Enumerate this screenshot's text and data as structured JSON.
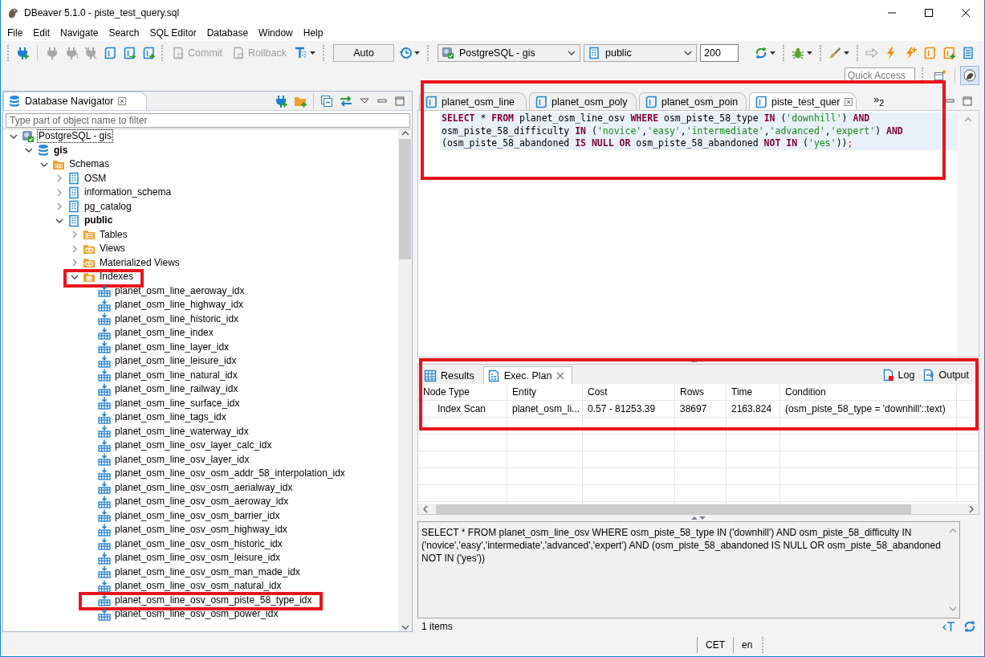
{
  "window": {
    "title": "DBeaver 5.1.0 - piste_test_query.sql"
  },
  "menu": [
    "File",
    "Edit",
    "Navigate",
    "Search",
    "SQL Editor",
    "Database",
    "Window",
    "Help"
  ],
  "toolbar": [
    {
      "kind": "grip"
    },
    {
      "kind": "icon",
      "disabled": false,
      "menu": false
    },
    {
      "kind": "divider"
    },
    {
      "kind": "icon",
      "disabled": true,
      "menu": false
    },
    {
      "kind": "icon",
      "disabled": true,
      "menu": false
    },
    {
      "kind": "icon",
      "disabled": true,
      "menu": false
    },
    {
      "kind": "icon",
      "disabled": false,
      "menu": false
    },
    {
      "kind": "icon",
      "disabled": false,
      "menu": false
    },
    {
      "kind": "icon",
      "disabled": false,
      "menu": false
    },
    {
      "kind": "grip"
    },
    {
      "kind": "button",
      "label": "Commit",
      "disabled": true
    },
    {
      "kind": "button",
      "label": "Rollback",
      "disabled": true
    },
    {
      "kind": "icon",
      "disabled": false,
      "menu": true
    },
    {
      "kind": "grip"
    },
    {
      "kind": "box",
      "label": "Auto"
    },
    {
      "kind": "icon",
      "disabled": false,
      "menu": true
    },
    {
      "kind": "grip"
    },
    {
      "kind": "select",
      "value": "PostgreSQL - gis"
    },
    {
      "kind": "select",
      "value": "public"
    },
    {
      "kind": "input",
      "value": "200"
    },
    {
      "kind": "icon",
      "disabled": false,
      "menu": true
    },
    {
      "kind": "grip"
    },
    {
      "kind": "icon",
      "disabled": false,
      "menu": true
    },
    {
      "kind": "grip"
    },
    {
      "kind": "icon",
      "disabled": false,
      "menu": true
    },
    {
      "kind": "grip"
    },
    {
      "kind": "icon",
      "disabled": true,
      "menu": false
    },
    {
      "kind": "icon",
      "disabled": false,
      "menu": false
    },
    {
      "kind": "icon",
      "disabled": false,
      "menu": false
    },
    {
      "kind": "icon",
      "disabled": false,
      "menu": false
    },
    {
      "kind": "icon",
      "disabled": false,
      "menu": false
    },
    {
      "kind": "icon",
      "disabled": false,
      "menu": false
    }
  ],
  "quick_access": {
    "placeholder": "Quick Access"
  },
  "navigator": {
    "title": "Database Navigator",
    "filter": {
      "placeholder": "Type part of object name to filter"
    },
    "tree": [
      {
        "label": "PostgreSQL - gis",
        "kind": "connection",
        "expanded": true,
        "active": false,
        "focused": true,
        "highlighted": false,
        "children": [
          {
            "label": "gis",
            "kind": "database",
            "expanded": true,
            "active": true,
            "highlighted": false,
            "children": [
              {
                "label": "Schemas",
                "kind": "schemas",
                "expanded": true,
                "active": false,
                "highlighted": false,
                "children": [
                  {
                    "label": "OSM",
                    "kind": "schema",
                    "expanded": false,
                    "active": false,
                    "highlighted": false
                  },
                  {
                    "label": "information_schema",
                    "kind": "schema",
                    "expanded": false,
                    "active": false,
                    "highlighted": false
                  },
                  {
                    "label": "pg_catalog",
                    "kind": "schema",
                    "expanded": false,
                    "active": false,
                    "highlighted": false
                  },
                  {
                    "label": "public",
                    "kind": "schema",
                    "expanded": true,
                    "active": true,
                    "highlighted": false,
                    "children": [
                      {
                        "label": "Tables",
                        "kind": "tables",
                        "expanded": false,
                        "active": false,
                        "highlighted": false
                      },
                      {
                        "label": "Views",
                        "kind": "views",
                        "expanded": false,
                        "active": false,
                        "highlighted": false
                      },
                      {
                        "label": "Materialized Views",
                        "kind": "views",
                        "expanded": false,
                        "active": false,
                        "highlighted": false
                      },
                      {
                        "label": "Indexes",
                        "kind": "indexes",
                        "expanded": true,
                        "active": false,
                        "highlighted": true,
                        "children": [
                          {
                            "label": "planet_osm_line_aeroway_idx",
                            "kind": "index",
                            "highlighted": false
                          },
                          {
                            "label": "planet_osm_line_highway_idx",
                            "kind": "index",
                            "highlighted": false
                          },
                          {
                            "label": "planet_osm_line_historic_idx",
                            "kind": "index",
                            "highlighted": false
                          },
                          {
                            "label": "planet_osm_line_index",
                            "kind": "index",
                            "highlighted": false
                          },
                          {
                            "label": "planet_osm_line_layer_idx",
                            "kind": "index",
                            "highlighted": false
                          },
                          {
                            "label": "planet_osm_line_leisure_idx",
                            "kind": "index",
                            "highlighted": false
                          },
                          {
                            "label": "planet_osm_line_natural_idx",
                            "kind": "index",
                            "highlighted": false
                          },
                          {
                            "label": "planet_osm_line_railway_idx",
                            "kind": "index",
                            "highlighted": false
                          },
                          {
                            "label": "planet_osm_line_surface_idx",
                            "kind": "index",
                            "highlighted": false
                          },
                          {
                            "label": "planet_osm_line_tags_idx",
                            "kind": "index",
                            "highlighted": false
                          },
                          {
                            "label": "planet_osm_line_waterway_idx",
                            "kind": "index",
                            "highlighted": false
                          },
                          {
                            "label": "planet_osm_line_osv_layer_calc_idx",
                            "kind": "index",
                            "highlighted": false
                          },
                          {
                            "label": "planet_osm_line_osv_layer_idx",
                            "kind": "index",
                            "highlighted": false
                          },
                          {
                            "label": "planet_osm_line_osv_osm_addr_58_interpolation_idx",
                            "kind": "index",
                            "highlighted": false
                          },
                          {
                            "label": "planet_osm_line_osv_osm_aerialway_idx",
                            "kind": "index",
                            "highlighted": false
                          },
                          {
                            "label": "planet_osm_line_osv_osm_aeroway_idx",
                            "kind": "index",
                            "highlighted": false
                          },
                          {
                            "label": "planet_osm_line_osv_osm_barrier_idx",
                            "kind": "index",
                            "highlighted": false
                          },
                          {
                            "label": "planet_osm_line_osv_osm_highway_idx",
                            "kind": "index",
                            "highlighted": false
                          },
                          {
                            "label": "planet_osm_line_osv_osm_historic_idx",
                            "kind": "index",
                            "highlighted": false
                          },
                          {
                            "label": "planet_osm_line_osv_osm_leisure_idx",
                            "kind": "index",
                            "highlighted": false
                          },
                          {
                            "label": "planet_osm_line_osv_osm_man_made_idx",
                            "kind": "index",
                            "highlighted": false
                          },
                          {
                            "label": "planet_osm_line_osv_osm_natural_idx",
                            "kind": "index",
                            "highlighted": false
                          },
                          {
                            "label": "planet_osm_line_osv_osm_piste_58_type_idx",
                            "kind": "index",
                            "highlighted": true
                          },
                          {
                            "label": "planet_osm_line_osv_osm_power_idx",
                            "kind": "index",
                            "highlighted": false
                          }
                        ]
                      }
                    ]
                  }
                ]
              }
            ]
          }
        ]
      }
    ]
  },
  "editor": {
    "highlighted": true,
    "tabs": [
      {
        "label": "planet_osm_line",
        "selected": false
      },
      {
        "label": "planet_osm_poly",
        "selected": false
      },
      {
        "label": "planet_osm_poin",
        "selected": false
      },
      {
        "label": "piste_test_quer",
        "selected": true
      }
    ],
    "overflow": "»$_{2}$",
    "lines": [
      [
        {
          "kind": "keyword",
          "text": "SELECT"
        },
        {
          "kind": "plain",
          "text": " * "
        },
        {
          "kind": "keyword",
          "text": "FROM"
        },
        {
          "kind": "plain",
          "text": " planet_osm_line_osv "
        },
        {
          "kind": "keyword",
          "text": "WHERE"
        },
        {
          "kind": "plain",
          "text": " osm_piste_58_type "
        },
        {
          "kind": "keyword",
          "text": "IN"
        },
        {
          "kind": "plain",
          "text": " ("
        },
        {
          "kind": "string",
          "text": "'downhill'"
        },
        {
          "kind": "plain",
          "text": ") "
        },
        {
          "kind": "keyword",
          "text": "AND"
        }
      ],
      [
        {
          "kind": "plain",
          "text": "osm_piste_58_difficulty "
        },
        {
          "kind": "keyword",
          "text": "IN"
        },
        {
          "kind": "plain",
          "text": " ("
        },
        {
          "kind": "string",
          "text": "'novice'"
        },
        {
          "kind": "plain",
          "text": ","
        },
        {
          "kind": "string",
          "text": "'easy'"
        },
        {
          "kind": "plain",
          "text": ","
        },
        {
          "kind": "string",
          "text": "'intermediate'"
        },
        {
          "kind": "plain",
          "text": ","
        },
        {
          "kind": "string",
          "text": "'advanced'"
        },
        {
          "kind": "plain",
          "text": ","
        },
        {
          "kind": "string",
          "text": "'expert'"
        },
        {
          "kind": "plain",
          "text": ") "
        },
        {
          "kind": "keyword",
          "text": "AND"
        }
      ],
      [
        {
          "kind": "plain",
          "text": "(osm_piste_58_abandoned "
        },
        {
          "kind": "keyword",
          "text": "IS NULL OR"
        },
        {
          "kind": "plain",
          "text": " osm_piste_58_abandoned "
        },
        {
          "kind": "keyword",
          "text": "NOT IN"
        },
        {
          "kind": "plain",
          "text": " ("
        },
        {
          "kind": "string",
          "text": "'yes'"
        },
        {
          "kind": "plain",
          "text": "))"
        },
        {
          "kind": "delimiter",
          "text": ";"
        }
      ]
    ]
  },
  "results": {
    "highlighted": true,
    "tabs": [
      {
        "label": "Results",
        "selected": false
      },
      {
        "label": "Exec. Plan",
        "selected": true
      }
    ],
    "actions": [
      "Log",
      "Output"
    ],
    "columns": [
      "Node Type",
      "Entity",
      "Cost",
      "Rows",
      "Time",
      "Condition"
    ],
    "rows": [
      [
        "Index Scan",
        "planet_osm_li...",
        "0.57 - 81253.39",
        "38697",
        "2163.824",
        "(osm_piste_58_type = 'downhill'::text)"
      ]
    ],
    "query_text": "SELECT * FROM planet_osm_line_osv WHERE osm_piste_58_type IN ('downhill') AND osm_piste_58_difficulty IN ('novice','easy','intermediate','advanced','expert') AND (osm_piste_58_abandoned IS NULL OR osm_piste_58_abandoned NOT IN ('yes'))",
    "count": "1 items"
  },
  "status_bar": [
    "CET",
    "en"
  ]
}
